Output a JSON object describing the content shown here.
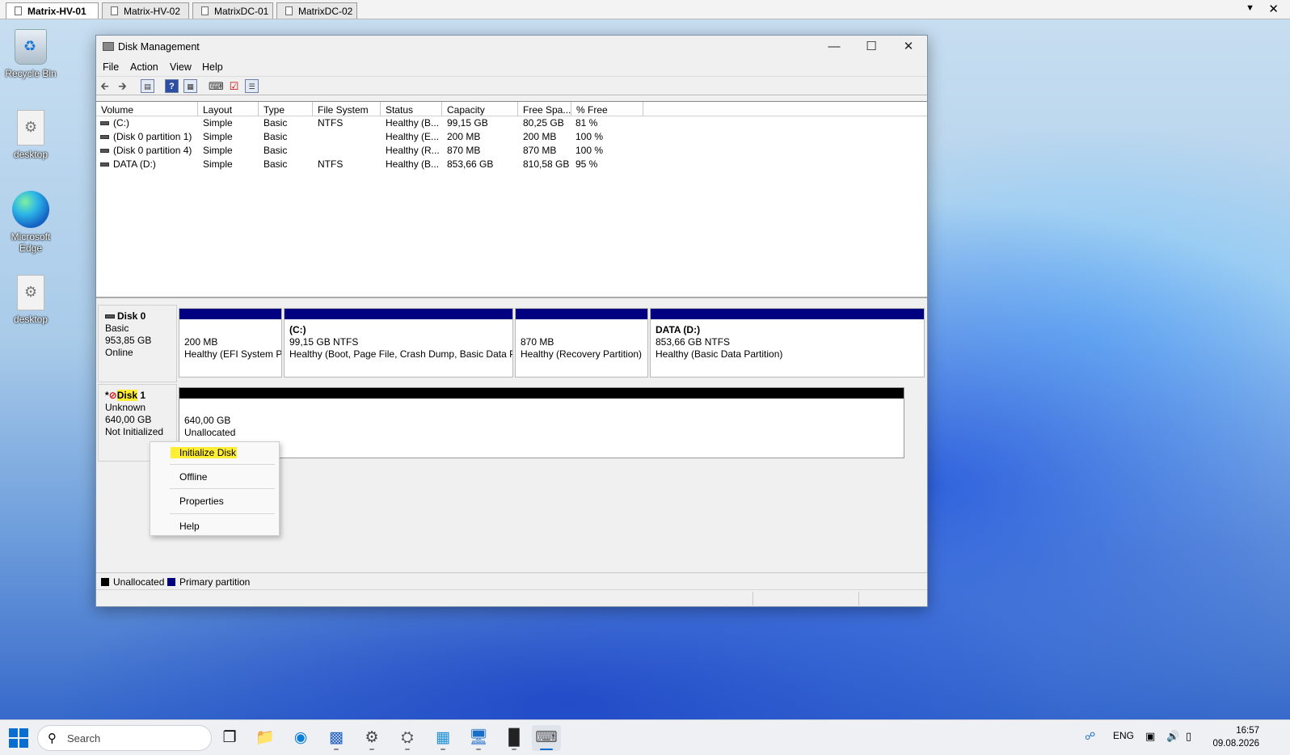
{
  "session_tabs": [
    {
      "label": "Matrix-HV-01",
      "active": true
    },
    {
      "label": "Matrix-HV-02",
      "active": false
    },
    {
      "label": "MatrixDC-01",
      "active": false
    },
    {
      "label": "MatrixDC-02",
      "active": false
    }
  ],
  "desktop_icons": [
    {
      "label": "Recycle Bin",
      "icon": "recycle-bin-icon"
    },
    {
      "label": "desktop",
      "icon": "settings-file-icon"
    },
    {
      "label": "Microsoft Edge",
      "icon": "edge-icon"
    },
    {
      "label": "desktop",
      "icon": "settings-file-icon"
    }
  ],
  "window": {
    "title": "Disk Management",
    "menu": [
      "File",
      "Action",
      "View",
      "Help"
    ]
  },
  "volume_list": {
    "columns": [
      "Volume",
      "Layout",
      "Type",
      "File System",
      "Status",
      "Capacity",
      "Free Spa...",
      "% Free"
    ],
    "rows": [
      {
        "volume": "(C:)",
        "layout": "Simple",
        "type": "Basic",
        "fs": "NTFS",
        "status": "Healthy (B...",
        "capacity": "99,15 GB",
        "free": "80,25 GB",
        "pct": "81 %"
      },
      {
        "volume": "(Disk 0 partition 1)",
        "layout": "Simple",
        "type": "Basic",
        "fs": "",
        "status": "Healthy (E...",
        "capacity": "200 MB",
        "free": "200 MB",
        "pct": "100 %"
      },
      {
        "volume": "(Disk 0 partition 4)",
        "layout": "Simple",
        "type": "Basic",
        "fs": "",
        "status": "Healthy (R...",
        "capacity": "870 MB",
        "free": "870 MB",
        "pct": "100 %"
      },
      {
        "volume": "DATA (D:)",
        "layout": "Simple",
        "type": "Basic",
        "fs": "NTFS",
        "status": "Healthy (B...",
        "capacity": "853,66 GB",
        "free": "810,58 GB",
        "pct": "95 %"
      }
    ]
  },
  "disks": {
    "disk0": {
      "name": "Disk 0",
      "type": "Basic",
      "size": "953,85 GB",
      "state": "Online",
      "partitions": [
        {
          "name": "",
          "size": "200 MB",
          "status": "Healthy (EFI System Pa"
        },
        {
          "name": "(C:)",
          "size": "99,15 GB NTFS",
          "status": "Healthy (Boot, Page File, Crash Dump, Basic Data Pa"
        },
        {
          "name": "",
          "size": "870 MB",
          "status": "Healthy (Recovery Partition)"
        },
        {
          "name": "DATA  (D:)",
          "size": "853,66 GB NTFS",
          "status": "Healthy (Basic Data Partition)"
        }
      ]
    },
    "disk1": {
      "prefix": "*",
      "name_hl": "Disk",
      "name_rest": " 1",
      "type": "Unknown",
      "size": "640,00 GB",
      "state": "Not Initialized",
      "unallocated": {
        "size": "640,00 GB",
        "label": "Unallocated"
      }
    }
  },
  "context_menu": [
    "Initialize Disk",
    "Offline",
    "Properties",
    "Help"
  ],
  "legend": [
    "Unallocated",
    "Primary partition"
  ],
  "legend_colors": {
    "unallocated": "#000000",
    "primary": "#000080"
  },
  "taskbar": {
    "search_placeholder": "Search",
    "tray_lang": "ENG",
    "time": "16:57",
    "date": "09.08.2026"
  }
}
